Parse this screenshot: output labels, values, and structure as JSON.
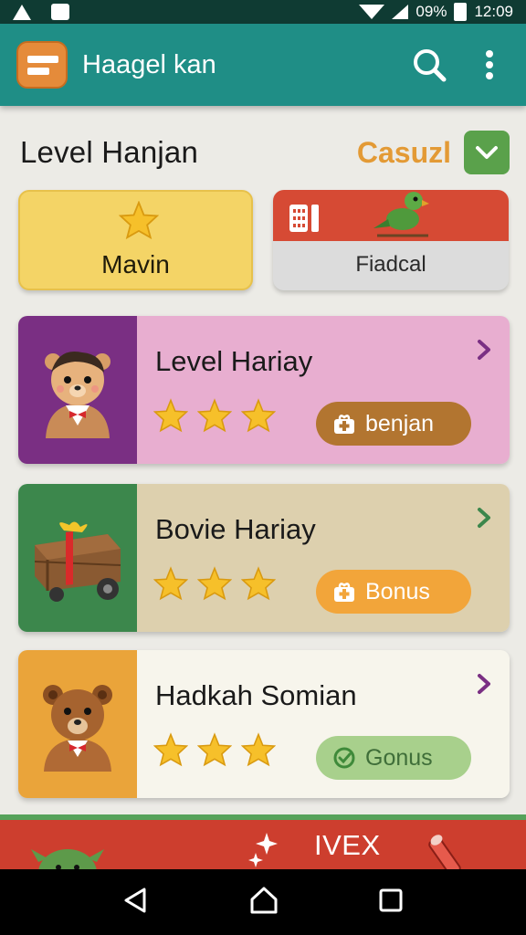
{
  "status_bar": {
    "battery": "09%",
    "time": "12:09"
  },
  "app_bar": {
    "title": "Haagel kan"
  },
  "section": {
    "title": "Level Hanjan",
    "mode": "Casuzl"
  },
  "categories": [
    {
      "label": "Mavin",
      "icon": "star-icon"
    },
    {
      "label": "Fiadcal",
      "icon": "parrot-icon"
    }
  ],
  "levels": [
    {
      "title": "Level Hariay",
      "stars": 3,
      "badge": "benjan",
      "badge_icon": "gift-icon"
    },
    {
      "title": "Bovie Hariay",
      "stars": 3,
      "badge": "Bonus",
      "badge_icon": "gift-icon"
    },
    {
      "title": "Hadkah Somian",
      "stars": 3,
      "badge": "Gonus",
      "badge_icon": "check-circle-icon"
    }
  ],
  "banner": {
    "label": "IVEX"
  },
  "colors": {
    "app_bar": "#1f8e86",
    "accent_orange": "#e39a35",
    "star": "#f6c02a",
    "banner": "#cd3e2e"
  }
}
